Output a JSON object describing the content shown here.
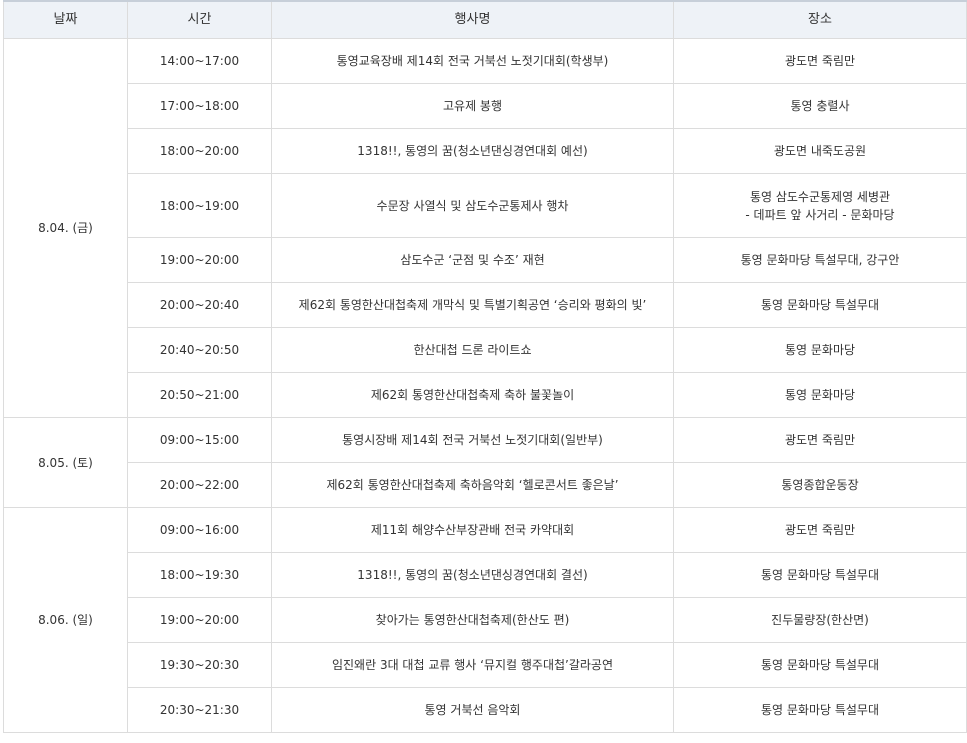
{
  "header": {
    "date": "날짜",
    "time": "시간",
    "event": "행사명",
    "place": "장소"
  },
  "days": [
    {
      "date": "8.04. (금)",
      "rows": [
        {
          "time": "14:00~17:00",
          "event": "통영교육장배 제14회 전국 거북선 노젓기대회(학생부)",
          "place": [
            "광도면 죽림만"
          ]
        },
        {
          "time": "17:00~18:00",
          "event": "고유제 봉행",
          "place": [
            "통영 충렬사"
          ]
        },
        {
          "time": "18:00~20:00",
          "event": "1318!!, 통영의 꿈(청소년댄싱경연대회 예선)",
          "place": [
            "광도면 내죽도공원"
          ]
        },
        {
          "time": "18:00~19:00",
          "event": "수문장 사열식 및 삼도수군통제사 행차",
          "place": [
            "통영 삼도수군통제영 세병관",
            "- 데파트 앞 사거리 - 문화마당"
          ],
          "tall": true
        },
        {
          "time": "19:00~20:00",
          "event": "삼도수군 ‘군점 및 수조’ 재현",
          "place": [
            "통영 문화마당 특설무대, 강구안"
          ]
        },
        {
          "time": "20:00~20:40",
          "event": "제62회 통영한산대첩축제 개막식 및 특별기획공연 ‘승리와 평화의 빛’",
          "place": [
            "통영 문화마당 특설무대"
          ]
        },
        {
          "time": "20:40~20:50",
          "event": "한산대첩 드론 라이트쇼",
          "place": [
            "통영 문화마당"
          ]
        },
        {
          "time": "20:50~21:00",
          "event": "제62회 통영한산대첩축제 축하 불꽃놀이",
          "place": [
            "통영 문화마당"
          ]
        }
      ]
    },
    {
      "date": "8.05. (토)",
      "rows": [
        {
          "time": "09:00~15:00",
          "event": "통영시장배 제14회 전국 거북선 노젓기대회(일반부)",
          "place": [
            "광도면 죽림만"
          ]
        },
        {
          "time": "20:00~22:00",
          "event": "제62회 통영한산대첩축제 축하음악회 ‘헬로콘서트 좋은날’",
          "place": [
            "통영종합운동장"
          ]
        }
      ]
    },
    {
      "date": "8.06. (일)",
      "rows": [
        {
          "time": "09:00~16:00",
          "event": "제11회 해양수산부장관배 전국 카약대회",
          "place": [
            "광도면 죽림만"
          ]
        },
        {
          "time": "18:00~19:30",
          "event": "1318!!, 통영의 꿈(청소년댄싱경연대회 결선)",
          "place": [
            "통영 문화마당 특설무대"
          ]
        },
        {
          "time": "19:00~20:00",
          "event": "찾아가는 통영한산대첩축제(한산도 편)",
          "place": [
            "진두물량장(한산면)"
          ]
        },
        {
          "time": "19:30~20:30",
          "event": "임진왜란 3대 대첩 교류 행사 ‘뮤지컬 행주대첩’갈라공연",
          "place": [
            "통영 문화마당 특설무대"
          ]
        },
        {
          "time": "20:30~21:30",
          "event": "통영 거북선 음악회",
          "place": [
            "통영 문화마당 특설무대"
          ]
        }
      ]
    }
  ]
}
